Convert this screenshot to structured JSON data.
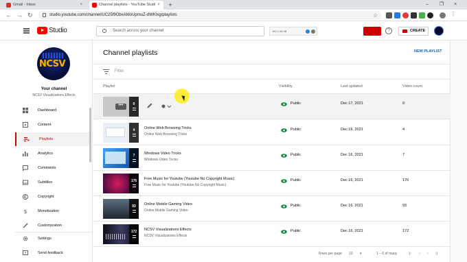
{
  "browser": {
    "tabs": [
      {
        "label": "Gmail - Inbox",
        "close": "×"
      },
      {
        "label": "Channel playlists - YouTube Studi",
        "close": "×"
      }
    ],
    "new_tab": "+",
    "window_controls": [
      "–",
      "❐",
      "×"
    ],
    "nav": {
      "back": "←",
      "forward": "→",
      "reload": "↻"
    },
    "url": "studio.youtube.com/channel/UC25f9ObxAMoUpmuZ-dWKtxg/playlists",
    "bookmark": "☆"
  },
  "header": {
    "logo_text": "Studio",
    "search_placeholder": "Search across your channel",
    "ext_text": "162  1  96  48",
    "help": "?",
    "create_label": "CREATE"
  },
  "sidebar": {
    "avatar_text": "NCSV",
    "your_channel": "Your channel",
    "channel_name": "NCSV Visualizations Effects",
    "items": [
      {
        "label": "Dashboard",
        "icon": "dashboard-icon"
      },
      {
        "label": "Content",
        "icon": "content-icon"
      },
      {
        "label": "Playlists",
        "icon": "playlists-icon",
        "active": true
      },
      {
        "label": "Analytics",
        "icon": "analytics-icon"
      },
      {
        "label": "Comments",
        "icon": "comments-icon"
      },
      {
        "label": "Subtitles",
        "icon": "subtitles-icon"
      },
      {
        "label": "Copyright",
        "icon": "copyright-icon"
      },
      {
        "label": "Monetization",
        "icon": "monetization-icon"
      },
      {
        "label": "Customization",
        "icon": "customization-icon"
      }
    ],
    "bottom_items": [
      {
        "label": "Settings",
        "icon": "settings-icon"
      },
      {
        "label": "Send feedback",
        "icon": "feedback-icon"
      }
    ]
  },
  "main": {
    "title": "Channel playlists",
    "new_playlist": "NEW PLAYLIST",
    "filter_label": "Filter",
    "columns": {
      "playlist": "Playlist",
      "visibility": "Visibility",
      "last_updated": "Last updated",
      "video_count": "Video count"
    },
    "rows": [
      {
        "title": "",
        "description": "",
        "count": "0",
        "visibility": "Public",
        "last_updated": "Dec 17, 2021",
        "video_count": "0",
        "thumb_color": "#c8c8c8",
        "hover": true,
        "dots": "•••"
      },
      {
        "title": "Online Web Browsing Tricks",
        "description": "Online Web Browsing Tricks",
        "count": "4",
        "visibility": "Public",
        "last_updated": "Dec 16, 2021",
        "video_count": "4",
        "thumb_color": "#e8eef5"
      },
      {
        "title": "Windows Video Tricks",
        "description": "Windows Video Tricks",
        "count": "7",
        "visibility": "Public",
        "last_updated": "Dec 16, 2021",
        "video_count": "7",
        "thumb_color": "#1976d2"
      },
      {
        "title": "Free Music for Youtube (Youtube No Copyright Music)",
        "description": "Free Music for Youtube (Youtube No Copyright Music)",
        "count": "176",
        "visibility": "Public",
        "last_updated": "Dec 16, 2021",
        "video_count": "176",
        "thumb_color": "#3a0a3a"
      },
      {
        "title": "Online Mobile Gaming Video",
        "description": "Online Mobile Gaming Video",
        "count": "93",
        "visibility": "Public",
        "last_updated": "Dec 16, 2021",
        "video_count": "93",
        "thumb_color": "#2b3540"
      },
      {
        "title": "NCSV Visualizations Effects",
        "description": "NCSV Visualizations Effects",
        "count": "172",
        "visibility": "Public",
        "last_updated": "Dec 16, 2021",
        "video_count": "172",
        "thumb_color": "#101018"
      }
    ],
    "pager": {
      "rows_per_page_label": "Rows per page:",
      "rows_per_page": "10",
      "range": "1 – 6 of many",
      "first": "|‹",
      "prev": "‹",
      "next": "›",
      "last": "›|"
    }
  },
  "colors": {
    "accent": "#c00",
    "link": "#065fd4",
    "visibility_icon": "#0f8a3c"
  }
}
